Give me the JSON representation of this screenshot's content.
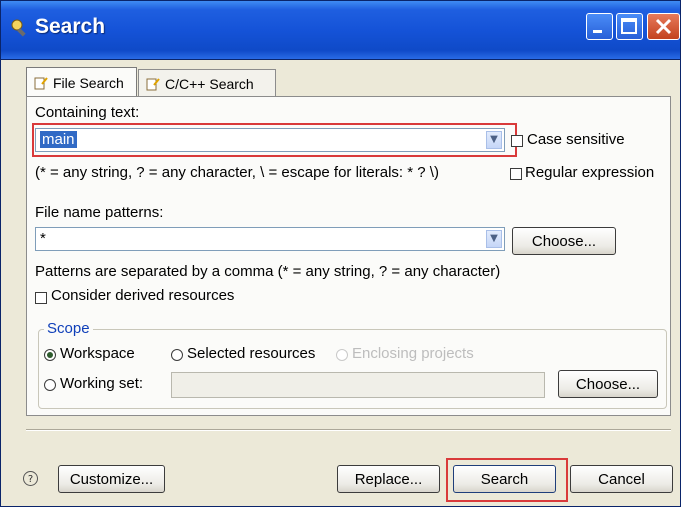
{
  "window": {
    "title": "Search"
  },
  "tabs": [
    {
      "label": "File Search",
      "active": true
    },
    {
      "label": "C/C++ Search",
      "active": false
    }
  ],
  "containing": {
    "label": "Containing text:",
    "value": "main",
    "case_sensitive": "Case sensitive",
    "hint": "(* = any string, ? = any character, \\ = escape for literals: * ? \\)",
    "regex": "Regular expression"
  },
  "patterns": {
    "label": "File name patterns:",
    "value": "*",
    "choose": "Choose...",
    "note": "Patterns are separated by a comma (* = any string, ? = any character)",
    "derived": "Consider derived resources"
  },
  "scope": {
    "legend": "Scope",
    "workspace": "Workspace",
    "selected": "Selected resources",
    "enclosing": "Enclosing projects",
    "working_set": "Working set:",
    "choose": "Choose..."
  },
  "footer": {
    "customize": "Customize...",
    "replace": "Replace...",
    "search": "Search",
    "cancel": "Cancel"
  },
  "colors": {
    "highlight": "#d93a3a",
    "title_bar": "#1553d8",
    "scope_legend": "#0f3fb9"
  }
}
